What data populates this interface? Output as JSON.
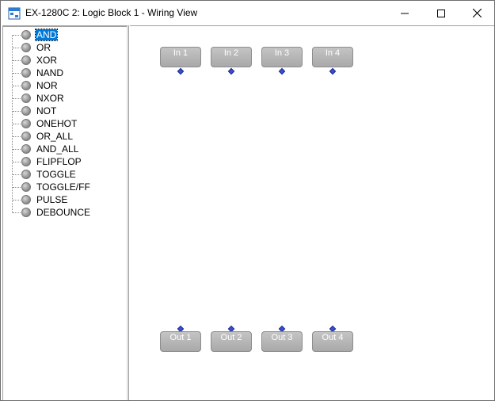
{
  "window": {
    "title": "EX-1280C 2: Logic Block 1 - Wiring View"
  },
  "tree": {
    "selected_index": 0,
    "items": [
      {
        "label": "AND"
      },
      {
        "label": "OR"
      },
      {
        "label": "XOR"
      },
      {
        "label": "NAND"
      },
      {
        "label": "NOR"
      },
      {
        "label": "NXOR"
      },
      {
        "label": "NOT"
      },
      {
        "label": "ONEHOT"
      },
      {
        "label": "OR_ALL"
      },
      {
        "label": "AND_ALL"
      },
      {
        "label": "FLIPFLOP"
      },
      {
        "label": "TOGGLE"
      },
      {
        "label": "TOGGLE/FF"
      },
      {
        "label": "PULSE"
      },
      {
        "label": "DEBOUNCE"
      }
    ]
  },
  "canvas": {
    "inputs": [
      {
        "label": "In 1"
      },
      {
        "label": "In 2"
      },
      {
        "label": "In 3"
      },
      {
        "label": "In 4"
      }
    ],
    "outputs": [
      {
        "label": "Out 1"
      },
      {
        "label": "Out 2"
      },
      {
        "label": "Out 3"
      },
      {
        "label": "Out 4"
      }
    ]
  },
  "colors": {
    "selection": "#0078d7",
    "pin": "#3a4fd0",
    "port": "#b0b0b0"
  }
}
